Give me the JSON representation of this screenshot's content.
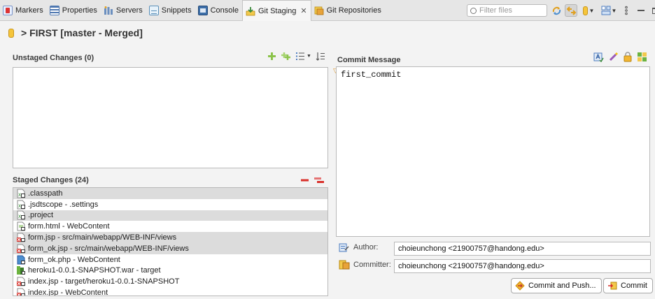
{
  "tabs": [
    {
      "label": "Markers",
      "icon": "markers-icon",
      "active": false
    },
    {
      "label": "Properties",
      "icon": "properties-icon",
      "active": false
    },
    {
      "label": "Servers",
      "icon": "servers-icon",
      "active": false
    },
    {
      "label": "Snippets",
      "icon": "snippets-icon",
      "active": false
    },
    {
      "label": "Console",
      "icon": "console-icon",
      "active": false
    },
    {
      "label": "Git Staging",
      "icon": "git-staging-icon",
      "active": true,
      "close": "✕"
    },
    {
      "label": "Git Repositories",
      "icon": "git-repositories-icon",
      "active": false
    }
  ],
  "filter": {
    "placeholder": "Filter files"
  },
  "repo": {
    "title": "> FIRST [master - Merged]"
  },
  "unstaged": {
    "title": "Unstaged Changes (0)",
    "files": []
  },
  "staged": {
    "title": "Staged Changes (24)",
    "files": [
      {
        "name": ".classpath",
        "icon": "xml-file-icon",
        "highlight": true
      },
      {
        "name": ".jsdtscope - .settings",
        "icon": "xml-file-icon",
        "highlight": false
      },
      {
        "name": ".project",
        "icon": "xml-file-icon",
        "highlight": true
      },
      {
        "name": "form.html - WebContent",
        "icon": "html-file-icon",
        "highlight": false
      },
      {
        "name": "form.jsp - src/main/webapp/WEB-INF/views",
        "icon": "jsp-file-icon",
        "highlight": true
      },
      {
        "name": "form_ok.jsp - src/main/webapp/WEB-INF/views",
        "icon": "jsp-file-icon",
        "highlight": true
      },
      {
        "name": "form_ok.php - WebContent",
        "icon": "php-file-icon",
        "highlight": false
      },
      {
        "name": "heroku1-0.0.1-SNAPSHOT.war - target",
        "icon": "war-file-icon",
        "highlight": false
      },
      {
        "name": "index.jsp - target/heroku1-0.0.1-SNAPSHOT",
        "icon": "jsp-file-icon",
        "highlight": false
      },
      {
        "name": "index.jsp - WebContent",
        "icon": "jsp-file-icon",
        "highlight": false
      }
    ]
  },
  "commit": {
    "title": "Commit Message",
    "message": "first_commit",
    "author_label": "Author:",
    "author": "choieunchong <21900757@handong.edu>",
    "committer_label": "Committer:",
    "committer": "choieunchong <21900757@handong.edu>",
    "commit_and_push_label": "Commit and Push...",
    "commit_label": "Commit"
  },
  "colors": {
    "accent_green": "#6cb33f",
    "remove_red": "#d9312b",
    "folder_yellow": "#f5c53b"
  }
}
